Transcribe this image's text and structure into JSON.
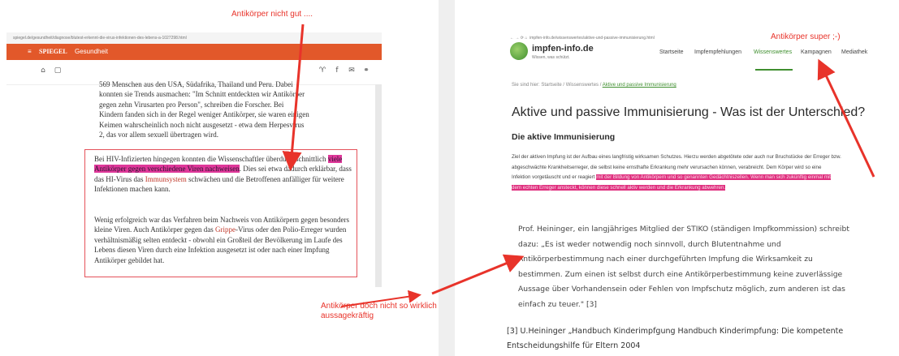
{
  "left_page": {
    "url": "spiegel.de/gesundheit/diagnose/blutest-erkennt-die-virus-infektionen-des-lebens-a-1027298.html",
    "header": {
      "menu_icon": "hamburger-icon",
      "brand": "SPIEGEL",
      "section": "Gesundheit"
    },
    "article": {
      "top_lines": [
        "569 Menschen aus den USA, Südafrika, Thailand und Peru. Dabei",
        "konnten sie Trends ausmachen: \"Im Schnitt entdeckten wir Antikörper",
        "gegen zehn Virusarten pro Person\", schreiben die Forscher. Bei",
        "Kindern fanden sich in der Regel weniger Antikörper, sie waren einigen",
        "Keimen wahrscheinlich noch nicht ausgesetzt - etwa dem Herpesvirus",
        "2, das vor allem sexuell übertragen wird."
      ],
      "p1_a": "Bei HIV-Infizierten hingegen konnten die Wissenschaftler überdurchschnittlich ",
      "p1_highlight": "viele Antikörper gegen verschiedene Viren nachweisen",
      "p1_b": ". Dies sei etwa dadurch erklärbar, dass das HI-Virus das ",
      "p1_link": "Immunsystem",
      "p1_c": " schwächen und die Betroffenen anfälliger für weitere Infektionen machen kann.",
      "p2_a": "Wenig erfolgreich war das Verfahren beim Nachweis von Antikörpern gegen besonders kleine Viren. Auch Antikörper gegen das ",
      "p2_link": "Grippe",
      "p2_b": "-Virus oder den Polio-Erreger wurden verhältnismäßig selten entdeckt - obwohl ein Großteil der Bevölkerung im Laufe des Lebens diesen Viren durch eine Infektion ausgesetzt ist oder nach einer Impfung Antikörper gebildet hat."
    }
  },
  "right_page": {
    "url": "impfen-info.de/wissenswertes/aktive-und-passive-immunisierung.html",
    "logo": {
      "name": "impfen-info.de",
      "tagline": "Wissen, was schützt."
    },
    "nav": [
      "Startseite",
      "Impfempfehlungen",
      "Wissenswertes",
      "Kampagnen",
      "Mediathek"
    ],
    "breadcrumb": {
      "prefix": "Sie sind hier: Startseite / Wissenswertes / ",
      "active": "Aktive und passive Immunisierung"
    },
    "title": "Aktive und passive Immunisierung - Was ist der Unterschied?",
    "subtitle": "Die aktive Immunisierung",
    "text_a": "Ziel der aktiven Impfung ist der Aufbau eines langfristig wirksamen Schutzes. Hierzu werden abgetötete oder auch nur Bruchstücke der Erreger bzw. abgeschwächte Krankheitserreger, die selbst keine ernsthafte Erkrankung mehr verursachen können, verabreicht. Dem Körper wird so eine Infektion vorgetäuscht und er reagiert ",
    "text_highlight": "mit der Bildung von Antikörpern und so genannten Gedächtniszellen. Wenn man sich zukünftig einmal mit dem echten Erreger ansteckt, können diese schnell aktiv werden und die Erkrankung abwehren.",
    "quote": "Prof. Heininger, ein langjähriges Mitglied der STIKO (ständigen Impfkommission) schreibt dazu: „Es ist weder notwendig noch sinnvoll, durch Blutentnahme und Antikörperbestimmung nach einer durchgeführten Impfung die Wirksamkeit zu bestimmen. Zum einen ist selbst durch eine Antikörperbestimmung keine zuverlässige Aussage über Vorhandensein oder Fehlen von Impfschutz möglich, zum anderen ist das einfach zu teuer.\" [3]",
    "reference": "[3] U.Heininger „Handbuch Kinderimpfgung Handbuch Kinderimpfung: Die kompetente Entscheidungshilfe für Eltern 2004"
  },
  "annotations": {
    "note_left": "Antikörper nicht gut ....",
    "note_right": "Antikörper super ;-)",
    "note_bottom_1": "Antikörper doch nicht so wirklich",
    "note_bottom_2": "aussagekräftig",
    "color": "#e8332a"
  },
  "colors": {
    "spiegel_orange": "#e2582a",
    "highlight_pink": "#e0389a",
    "impfen_green": "#3f8f2f"
  }
}
